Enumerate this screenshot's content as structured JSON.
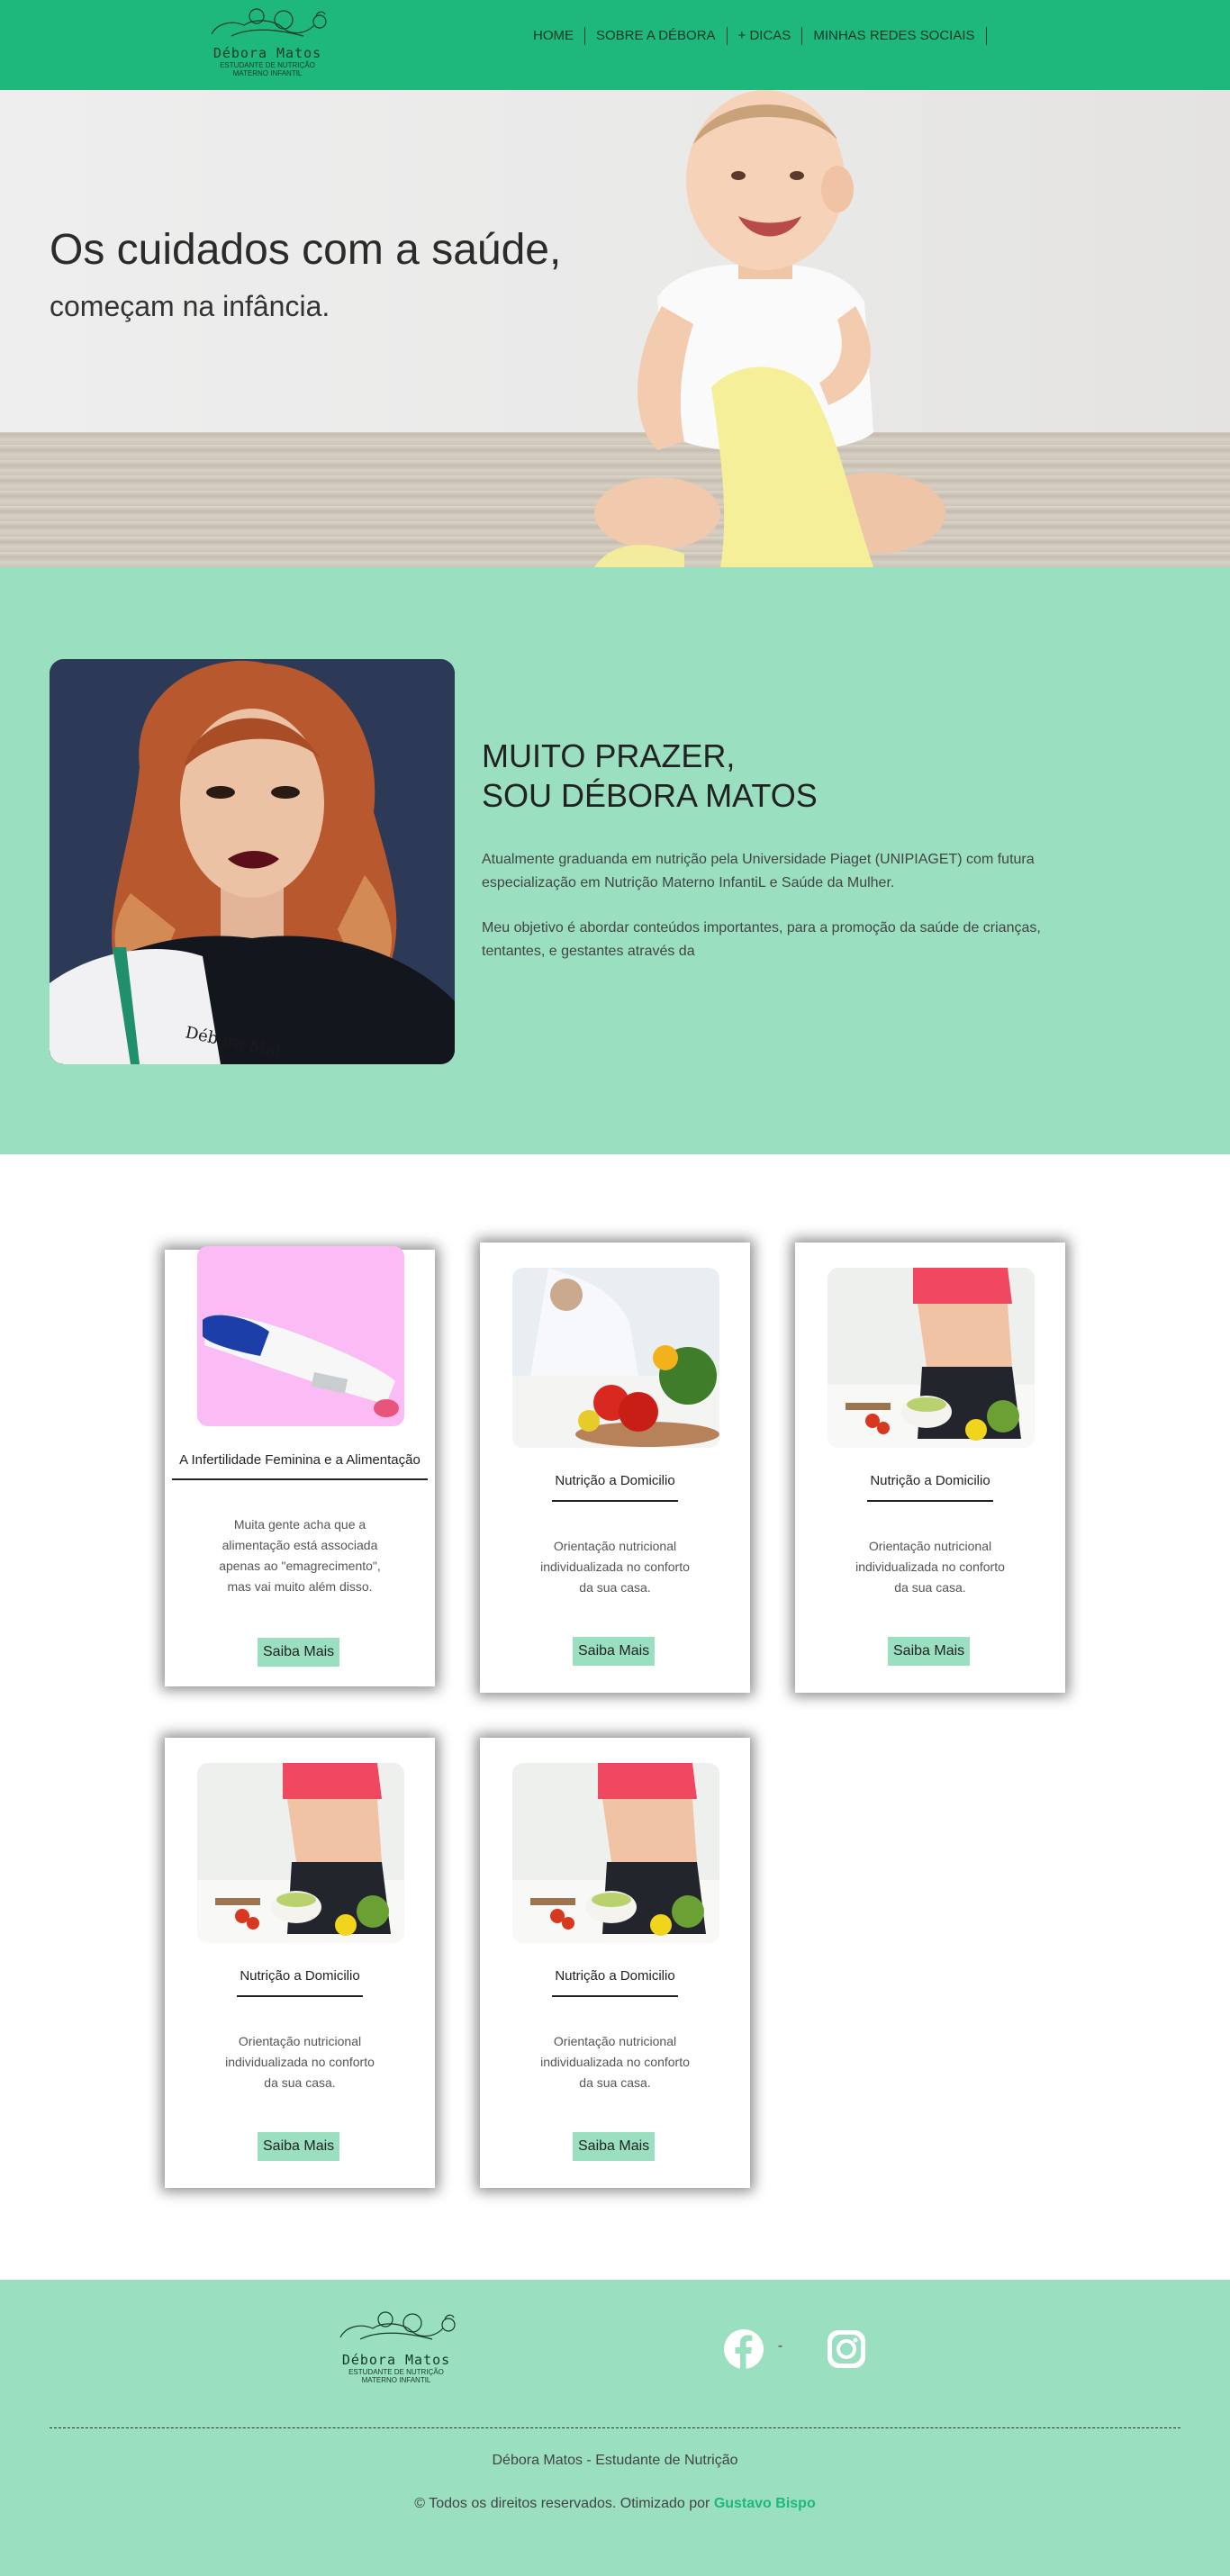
{
  "header": {
    "logo": {
      "name": "Débora Matos",
      "subtitle_line1": "ESTUDANTE DE NUTRIÇÃO",
      "subtitle_line2": "MATERNO INFANTIL"
    },
    "nav": [
      {
        "label": "HOME"
      },
      {
        "label": "SOBRE A DÉBORA"
      },
      {
        "label": "+ DICAS"
      },
      {
        "label": "MINHAS REDES SOCIAIS"
      }
    ]
  },
  "hero": {
    "title": "Os cuidados com a saúde,",
    "subtitle": "começam na infância."
  },
  "about": {
    "heading_line1": "MUITO PRAZER,",
    "heading_line2": "SOU DÉBORA MATOS",
    "paragraph1": "Atualmente graduanda em nutrição pela Universidade Piaget (UNIPIAGET) com futura especialização em Nutrição Materno InfantiL e Saúde da Mulher.",
    "paragraph2": "Meu objetivo é abordar conteúdos importantes, para a promoção da saúde de crianças, tentantes, e gestantes através da"
  },
  "cards": [
    {
      "title": "A Infertilidade Feminina e a Alimentação",
      "desc_line1": "Muita gente acha que a",
      "desc_line2": "alimentação está associada",
      "desc_line3": "apenas ao \"emagrecimento\",",
      "desc_line4": "mas vai muito além disso.",
      "button": "Saiba Mais"
    },
    {
      "title": "Nutrição a Domicilio",
      "desc_line1": "Orientação nutricional",
      "desc_line2": "individualizada no conforto",
      "desc_line3": "da sua casa.",
      "button": "Saiba Mais"
    },
    {
      "title": "Nutrição a Domicilio",
      "desc_line1": "Orientação nutricional",
      "desc_line2": "individualizada no conforto",
      "desc_line3": "da sua casa.",
      "button": "Saiba Mais"
    },
    {
      "title": "Nutrição a Domicilio",
      "desc_line1": "Orientação nutricional",
      "desc_line2": "individualizada no conforto",
      "desc_line3": "da sua casa.",
      "button": "Saiba Mais"
    },
    {
      "title": "Nutrição a Domicilio",
      "desc_line1": "Orientação nutricional",
      "desc_line2": "individualizada no conforto",
      "desc_line3": "da sua casa.",
      "button": "Saiba Mais"
    }
  ],
  "footer": {
    "logo": {
      "name": "Débora Matos",
      "subtitle_line1": "ESTUDANTE DE NUTRIÇÃO",
      "subtitle_line2": "MATERNO INFANTIL"
    },
    "social": [
      {
        "icon": "facebook-icon"
      },
      {
        "icon": "instagram-icon"
      }
    ],
    "separator": "-",
    "name_line": "Débora Matos - Estudante de Nutrição",
    "copyright": "© Todos os direitos reservados. Otimizado por",
    "author": "Gustavo Bispo"
  },
  "colors": {
    "header_green": "#1eb87c",
    "mint": "#99dfc0",
    "author_link": "#1eb87c",
    "card_image_pink": "#fbbcf5"
  }
}
